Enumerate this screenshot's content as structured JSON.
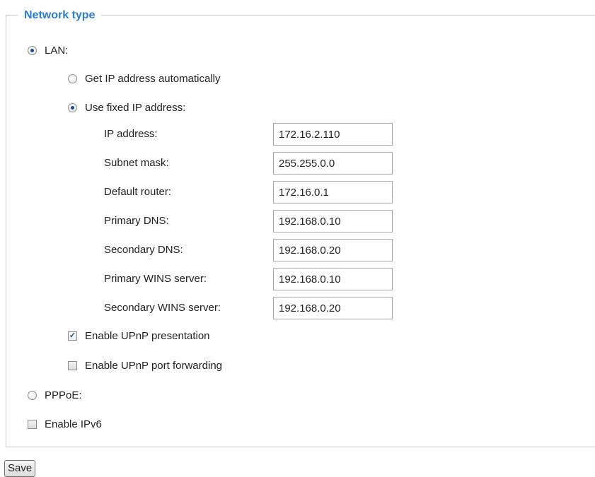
{
  "network_type": {
    "legend": "Network type",
    "lan": {
      "label": "LAN:",
      "selected": true
    },
    "get_ip_auto": {
      "label": "Get IP address automatically",
      "selected": false
    },
    "use_fixed_ip": {
      "label": "Use fixed IP address:",
      "selected": true
    },
    "fields": [
      {
        "label": "IP address:",
        "value": "172.16.2.110"
      },
      {
        "label": "Subnet mask:",
        "value": "255.255.0.0"
      },
      {
        "label": "Default router:",
        "value": "172.16.0.1"
      },
      {
        "label": "Primary DNS:",
        "value": "192.168.0.10"
      },
      {
        "label": "Secondary DNS:",
        "value": "192.168.0.20"
      },
      {
        "label": "Primary WINS server:",
        "value": "192.168.0.10"
      },
      {
        "label": "Secondary WINS server:",
        "value": "192.168.0.20"
      }
    ],
    "upnp_presentation": {
      "label": "Enable UPnP presentation",
      "checked": true
    },
    "upnp_port_forwarding": {
      "label": "Enable UPnP port forwarding",
      "checked": false
    },
    "pppoe": {
      "label": "PPPoE:",
      "selected": false
    },
    "ipv6": {
      "label": "Enable IPv6",
      "checked": false
    }
  },
  "save_label": "Save",
  "colors": {
    "legend": "#2b7fd0",
    "border": "#c8c8c8"
  }
}
